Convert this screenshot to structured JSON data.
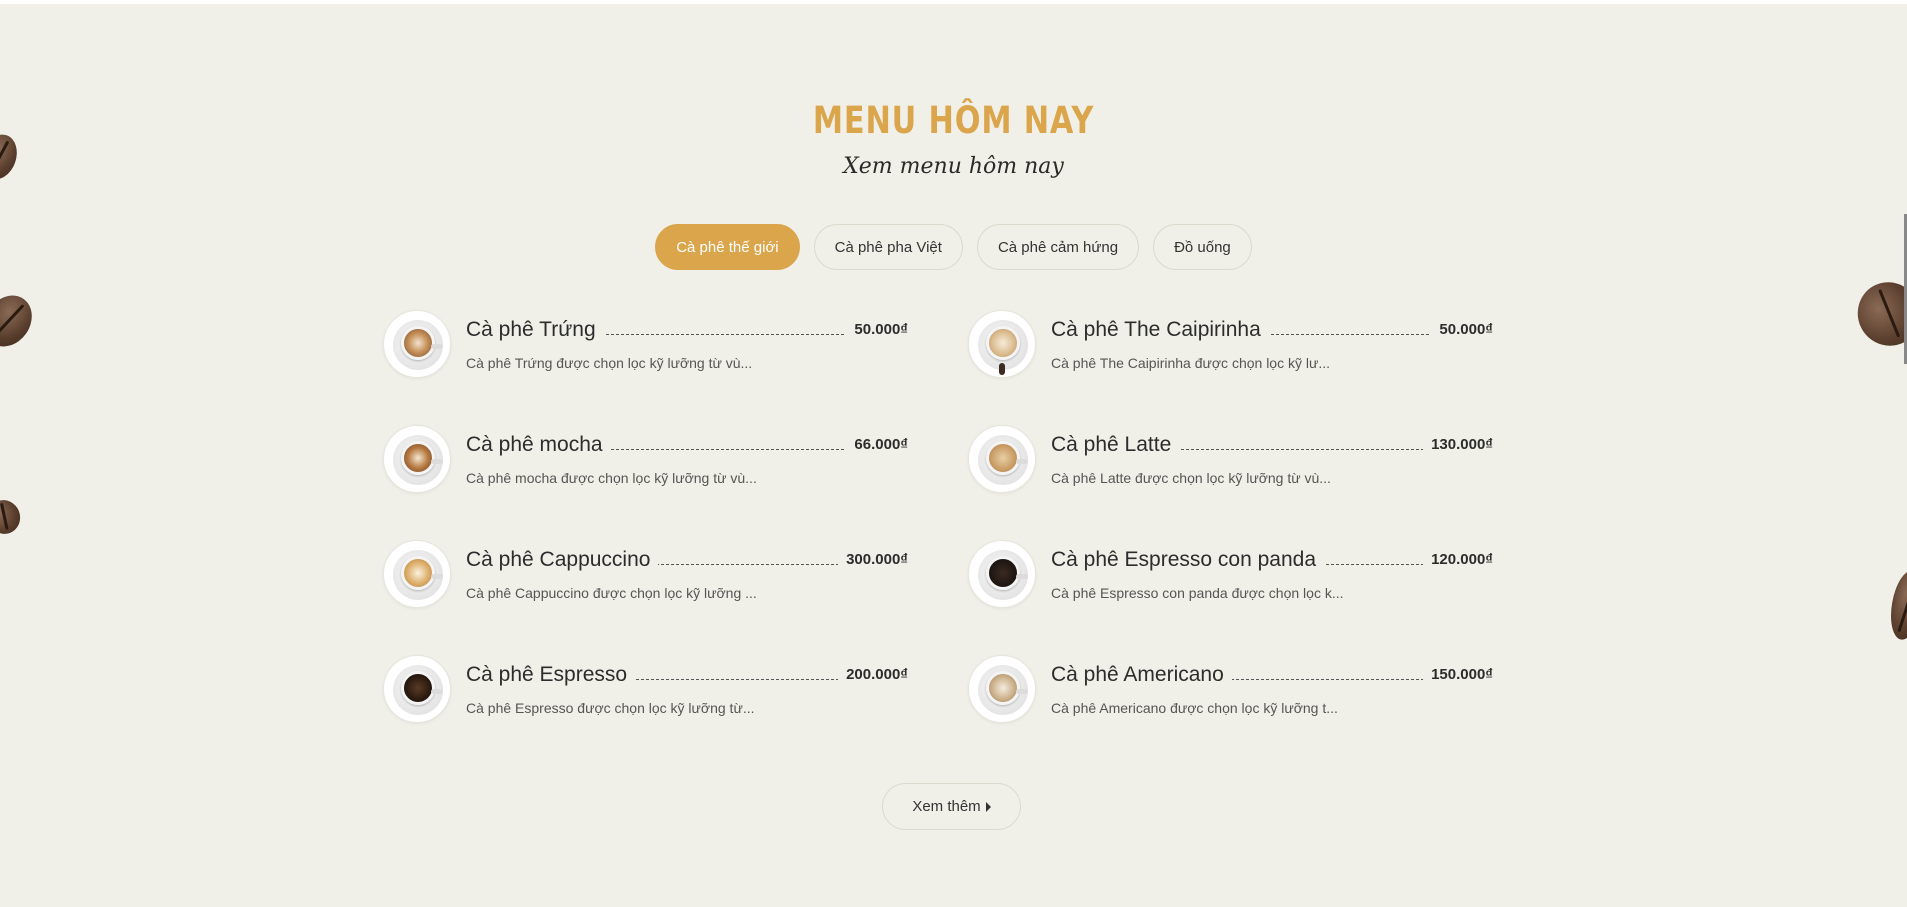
{
  "section": {
    "title": "MENU HÔM NAY",
    "subtitle": "Xem menu hôm nay"
  },
  "tabs": [
    {
      "label": "Cà phê thế giới",
      "active": true
    },
    {
      "label": "Cà phê pha Việt",
      "active": false
    },
    {
      "label": "Cà phê cảm hứng",
      "active": false
    },
    {
      "label": "Đồ uống",
      "active": false
    }
  ],
  "menu_items": [
    {
      "name": "Cà phê Trứng",
      "price": "50.000₫",
      "description": "Cà phê Trứng được chọn lọc kỹ lưỡng từ vù...",
      "image": "latte-art-cup-image"
    },
    {
      "name": "Cà phê The Caipirinha",
      "price": "50.000₫",
      "description": "Cà phê The Caipirinha được chọn lọc kỹ lư...",
      "image": "latte-cup-image"
    },
    {
      "name": "Cà phê mocha",
      "price": "66.000₫",
      "description": "Cà phê mocha được chọn lọc kỹ lưỡng từ vù...",
      "image": "mocha-cup-image"
    },
    {
      "name": "Cà phê Latte",
      "price": "130.000₫",
      "description": "Cà phê Latte được chọn lọc kỹ lưỡng từ vù...",
      "image": "latte-foam-cup-image"
    },
    {
      "name": "Cà phê Cappuccino",
      "price": "300.000₫",
      "description": "Cà phê Cappuccino được chọn lọc kỹ lưỡng ...",
      "image": "cappuccino-cup-image"
    },
    {
      "name": "Cà phê Espresso con panda",
      "price": "120.000₫",
      "description": "Cà phê Espresso con panda được chọn lọc k...",
      "image": "espresso-cup-image"
    },
    {
      "name": "Cà phê Espresso",
      "price": "200.000₫",
      "description": "Cà phê Espresso được chọn lọc kỹ lưỡng từ...",
      "image": "espresso-dark-cup-image"
    },
    {
      "name": "Cà phê Americano",
      "price": "150.000₫",
      "description": "Cà phê Americano được chọn lọc kỹ lưỡng t...",
      "image": "americano-cup-image"
    }
  ],
  "more_button": {
    "label": "Xem thêm",
    "icon": "caret-right-icon"
  },
  "colors": {
    "accent": "#dba54c",
    "background": "#f0f0e8",
    "text": "#2c2c2c"
  }
}
